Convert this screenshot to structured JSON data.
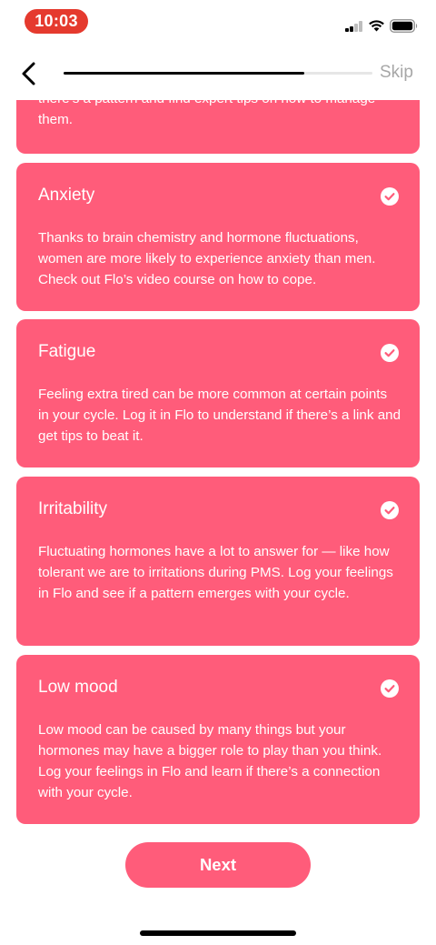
{
  "status_bar": {
    "time": "10:03"
  },
  "nav": {
    "skip_label": "Skip",
    "progress_fraction": 0.78
  },
  "cards": [
    {
      "title": "",
      "text": "there’s a pattern and find expert tips on how to manage them.",
      "checked": false
    },
    {
      "title": "Anxiety",
      "text": "Thanks to brain chemistry and hormone fluctuations, women are more likely to experience anxiety than men. Check out Flo’s video course on how to cope.",
      "checked": true
    },
    {
      "title": "Fatigue",
      "text": "Feeling extra tired can be more common at certain points in your cycle. Log it in Flo to understand if there’s a link and get tips to beat it.",
      "checked": true
    },
    {
      "title": "Irritability",
      "text": "Fluctuating hormones have a lot to answer for — like how tolerant we are to irritations during PMS. Log your feelings in Flo and see if a pattern emerges with your cycle.",
      "checked": true
    },
    {
      "title": "Low mood",
      "text": "Low mood can be caused by many things but your hormones may have a bigger role to play than you think. Log your feelings in Flo and learn if there’s a connection with your cycle.",
      "checked": true
    }
  ],
  "next_label": "Next",
  "colors": {
    "card": "#ff5c7a",
    "time_pill": "#e53a2e",
    "skip": "#a7a7a7"
  },
  "icons": {
    "back": "chevron-left-icon",
    "check": "check-circle-icon",
    "wifi": "wifi-icon",
    "battery": "battery-icon",
    "signal": "cellular-signal-icon"
  }
}
